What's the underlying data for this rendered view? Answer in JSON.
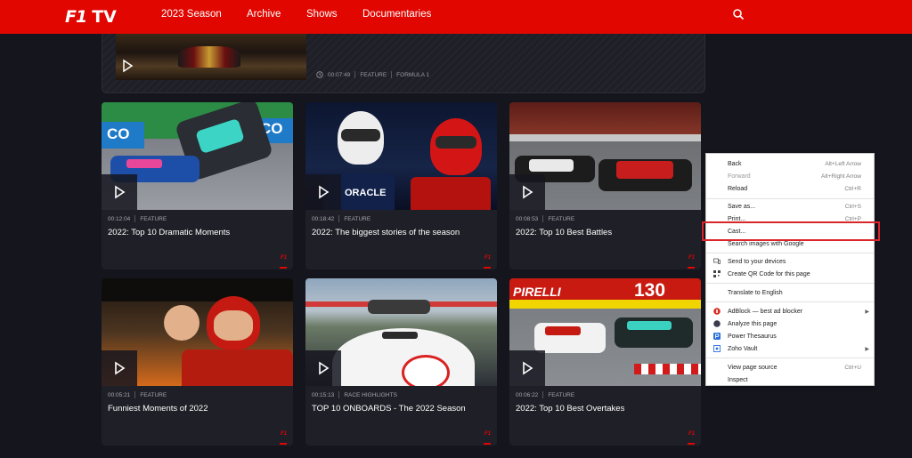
{
  "header": {
    "logo_f1": "F1",
    "logo_tv": "TV",
    "nav": [
      "2023 Season",
      "Archive",
      "Shows",
      "Documentaries"
    ],
    "search_icon": "search-icon",
    "brand_color": "#e10600"
  },
  "featured": {
    "duration": "00:07:49",
    "tag": "FEATURE",
    "category": "FORMULA 1"
  },
  "cards": [
    {
      "duration": "00:12:04",
      "tag": "FEATURE",
      "title": "2022: Top 10 Dramatic Moments",
      "brand": "F1"
    },
    {
      "duration": "00:18:42",
      "tag": "FEATURE",
      "title": "2022: The biggest stories of the season",
      "brand": "F1"
    },
    {
      "duration": "00:08:53",
      "tag": "FEATURE",
      "title": "2022: Top 10 Best Battles",
      "brand": "F1"
    },
    {
      "duration": "00:05:21",
      "tag": "FEATURE",
      "title": "Funniest Moments of 2022",
      "brand": "F1"
    },
    {
      "duration": "00:15:13",
      "tag": "RACE HIGHLIGHTS",
      "title": "TOP 10 ONBOARDS - The 2022 Season",
      "brand": "F1"
    },
    {
      "duration": "00:06:22",
      "tag": "FEATURE",
      "title": "2022: Top 10 Best Overtakes",
      "brand": "F1"
    }
  ],
  "thumb_text": {
    "card1_sponsor": "CO",
    "card1_sponsor2": "CO",
    "card2_sponsor": "ORACLE",
    "card6_sponsor": "PIRELLI",
    "card6_number": "130"
  },
  "context_menu": {
    "items": [
      {
        "label": "Back",
        "shortcut": "Alt+Left Arrow"
      },
      {
        "label": "Forward",
        "shortcut": "Alt+Right Arrow",
        "disabled": true
      },
      {
        "label": "Reload",
        "shortcut": "Ctrl+R"
      },
      {
        "label": "Save as...",
        "shortcut": "Ctrl+S"
      },
      {
        "label": "Print...",
        "shortcut": "Ctrl+P"
      },
      {
        "label": "Cast..."
      },
      {
        "label": "Search images with Google"
      },
      {
        "label": "Send to your devices",
        "icon": "device-icon"
      },
      {
        "label": "Create QR Code for this page",
        "icon": "qr-code-icon"
      },
      {
        "label": "Translate to English"
      },
      {
        "label": "AdBlock — best ad blocker",
        "icon": "adblock-icon",
        "submenu": true
      },
      {
        "label": "Analyze this page",
        "icon": "analyze-icon"
      },
      {
        "label": "Power Thesaurus",
        "icon": "power-thesaurus-icon"
      },
      {
        "label": "Zoho Vault",
        "icon": "zoho-vault-icon",
        "submenu": true
      },
      {
        "label": "View page source",
        "shortcut": "Ctrl+U"
      },
      {
        "label": "Inspect"
      }
    ],
    "highlighted_item": "Cast...",
    "highlight_color": "#d9262b"
  }
}
